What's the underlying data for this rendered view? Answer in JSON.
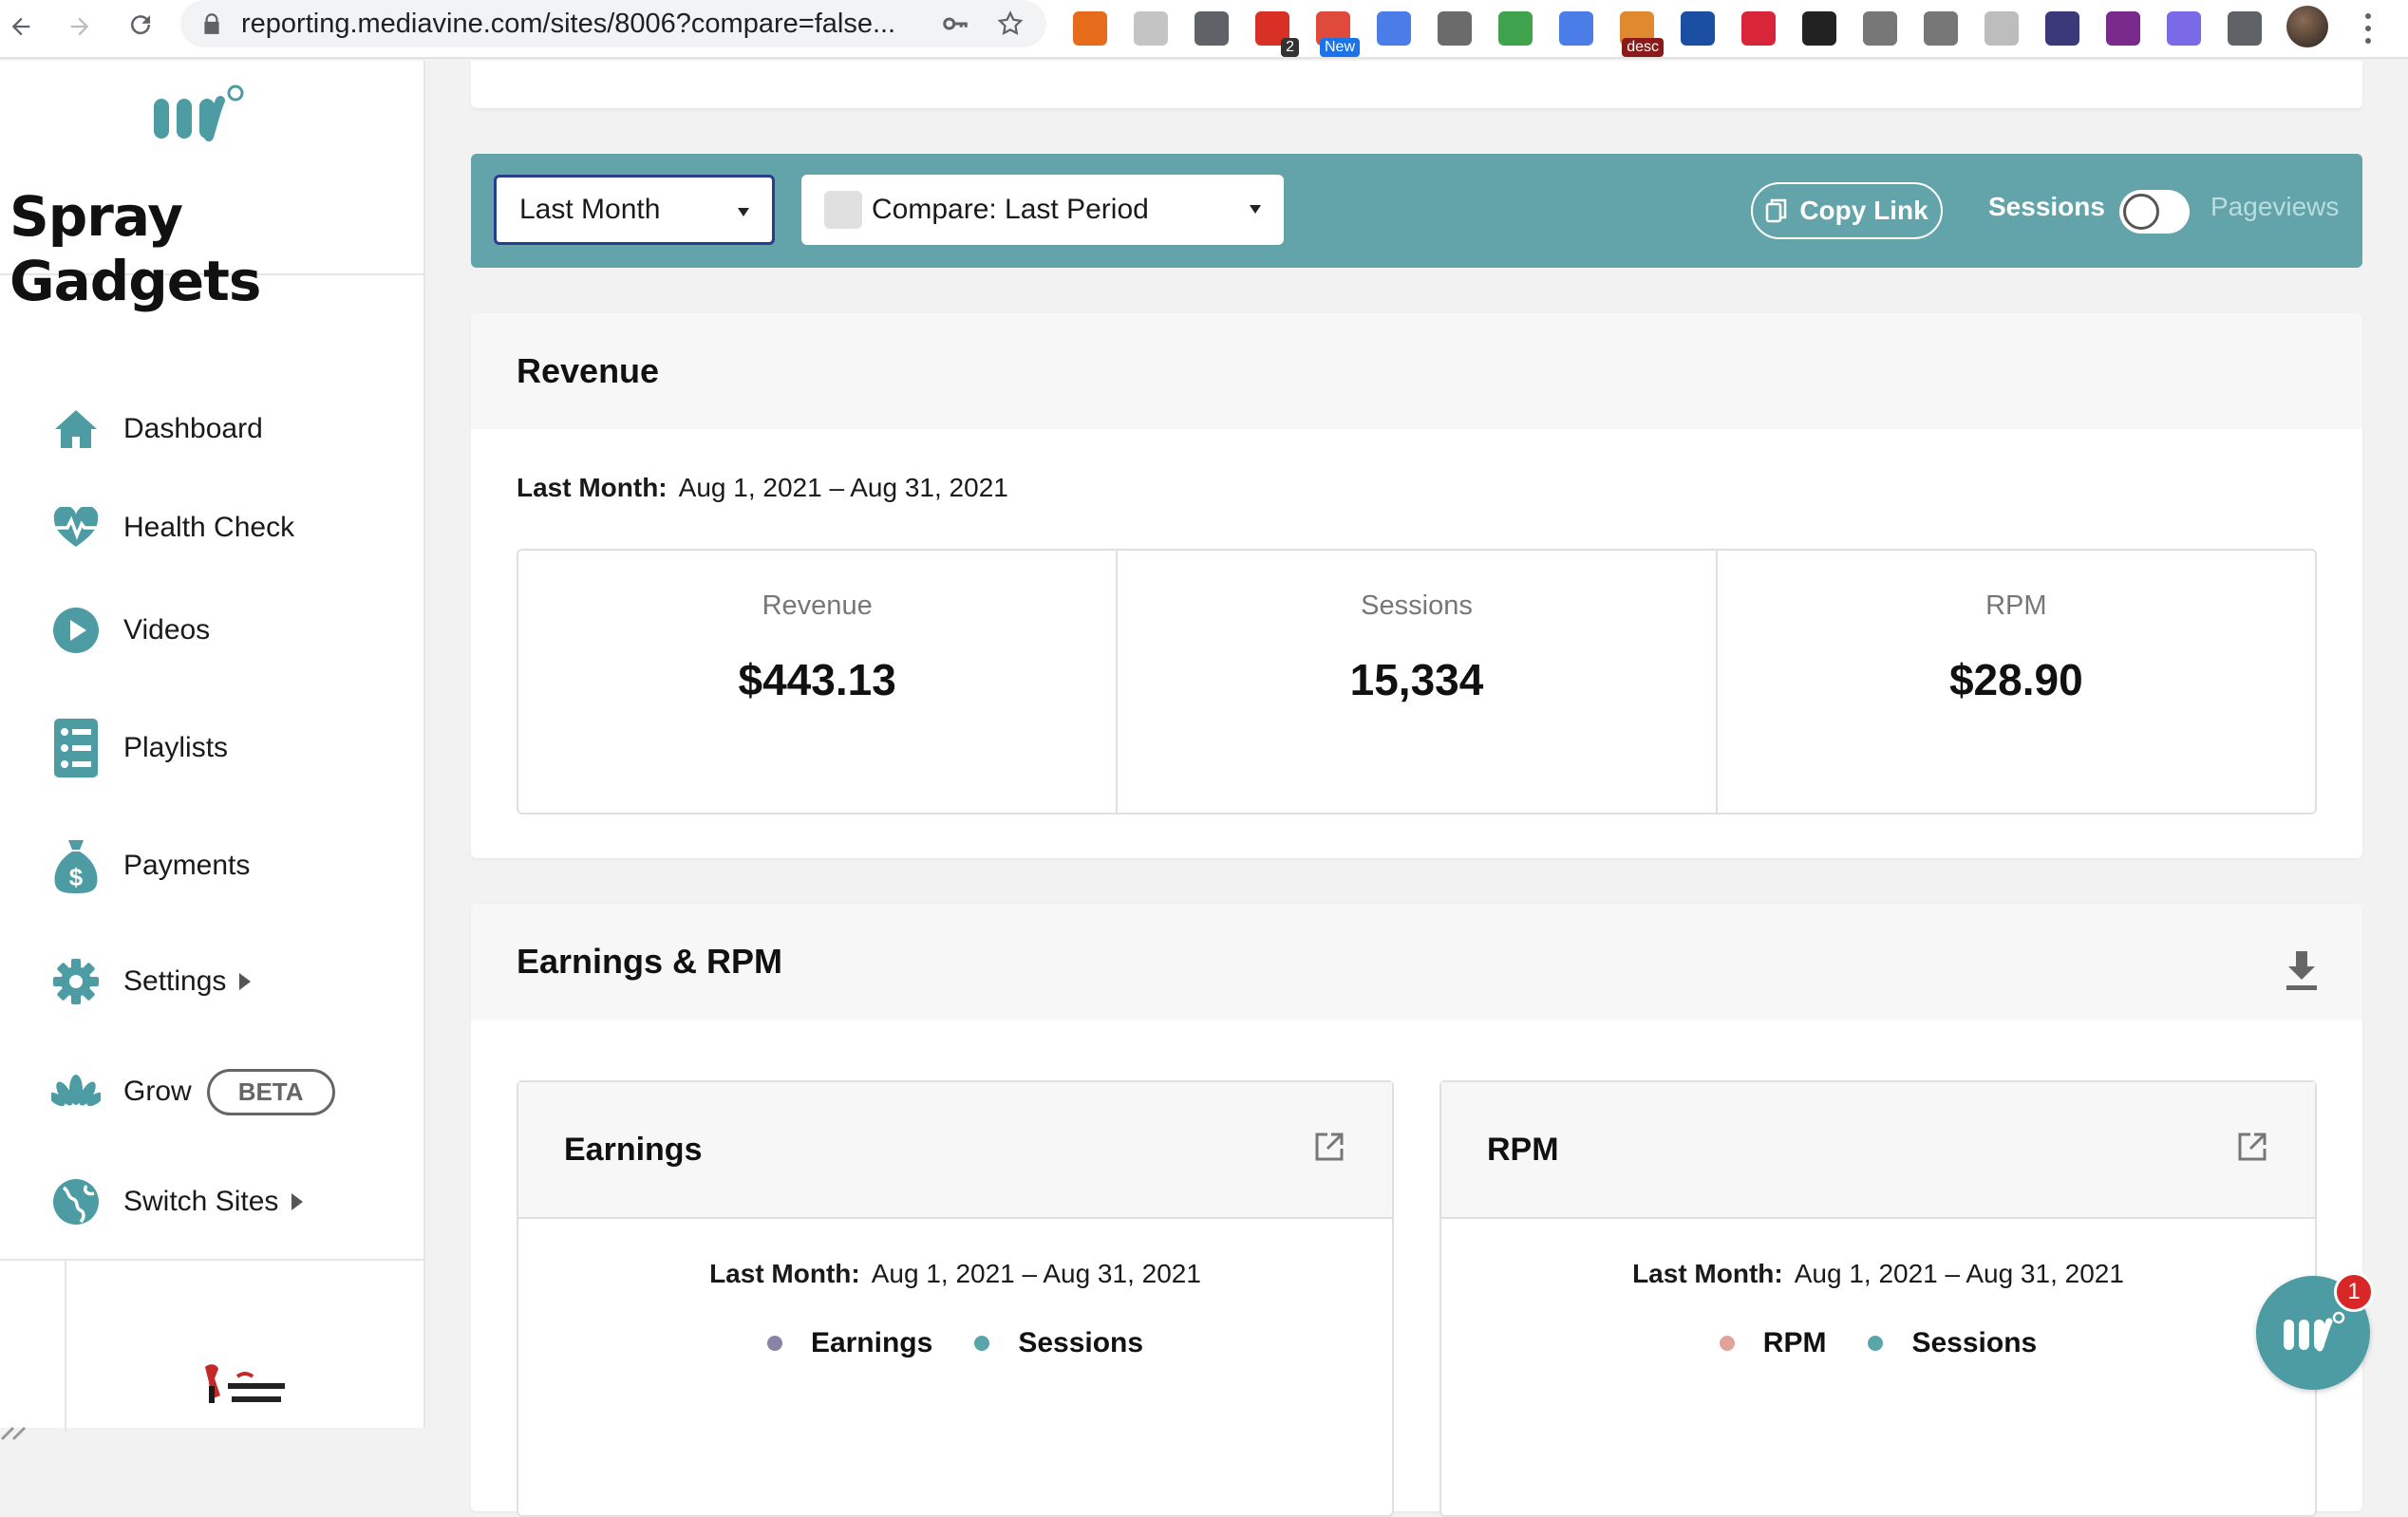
{
  "browser": {
    "url": "reporting.mediavine.com/sites/8006?compare=false...",
    "extensions": [
      {
        "name": "seo-extension-icon",
        "color": "#e66b1a",
        "badge": ""
      },
      {
        "name": "swirl-extension-icon",
        "color": "#c4c4c4",
        "badge": ""
      },
      {
        "name": "pocket-extension-icon",
        "color": "#5f6368",
        "badge": ""
      },
      {
        "name": "red-extension-icon",
        "color": "#d93025",
        "badge": "2"
      },
      {
        "name": "chrome-extension-icon",
        "color": "#e04a3a",
        "badge": "New"
      },
      {
        "name": "blue-folder-extension-icon",
        "color": "#4a7de8",
        "badge": ""
      },
      {
        "name": "chat-extension-icon",
        "color": "#6b6b6b",
        "badge": ""
      },
      {
        "name": "print-extension-icon",
        "color": "#3fa34d",
        "badge": ""
      },
      {
        "name": "link-extension-icon",
        "color": "#4a7de8",
        "badge": ""
      },
      {
        "name": "desc-extension-icon",
        "color": "#e0892e",
        "badge": "desc"
      },
      {
        "name": "plane-extension-icon",
        "color": "#1a4fa3",
        "badge": ""
      },
      {
        "name": "arrow-extension-icon",
        "color": "#d9253a",
        "badge": ""
      },
      {
        "name": "check-extension-icon",
        "color": "#222222",
        "badge": ""
      },
      {
        "name": "mail-extension-icon",
        "color": "#777777",
        "badge": ""
      },
      {
        "name": "camera-extension-icon",
        "color": "#777777",
        "badge": ""
      },
      {
        "name": "k-extension-icon",
        "color": "#bdbdbd",
        "badge": ""
      },
      {
        "name": "calendar-extension-icon",
        "color": "#3a3a7a",
        "badge": ""
      },
      {
        "name": "purple-extension-icon",
        "color": "#7a2a8a",
        "badge": ""
      },
      {
        "name": "snowflake-extension-icon",
        "color": "#7a6ae8",
        "badge": ""
      },
      {
        "name": "puzzle-extension-icon",
        "color": "#5f6368",
        "badge": ""
      }
    ]
  },
  "sidebar": {
    "site_name": "Spray Gadgets",
    "items": [
      {
        "label": "Dashboard",
        "icon": "home-icon"
      },
      {
        "label": "Health Check",
        "icon": "heartbeat-icon"
      },
      {
        "label": "Videos",
        "icon": "play-icon"
      },
      {
        "label": "Playlists",
        "icon": "list-icon"
      },
      {
        "label": "Payments",
        "icon": "money-bag-icon"
      },
      {
        "label": "Settings",
        "icon": "gear-icon"
      },
      {
        "label": "Grow",
        "icon": "lotus-icon"
      },
      {
        "label": "Switch Sites",
        "icon": "globe-icon"
      }
    ],
    "grow_badge": "BETA",
    "accent": "#4d9ca3"
  },
  "filters": {
    "date_range": "Last Month",
    "compare": "Compare: Last Period",
    "copy_link": "Copy Link",
    "toggle_on": "Sessions",
    "toggle_off": "Pageviews",
    "bar_color": "#63a4aa"
  },
  "revenue": {
    "title": "Revenue",
    "period_label": "Last Month:",
    "period_range": "Aug 1, 2021 – Aug 31, 2021",
    "metrics": [
      {
        "label": "Revenue",
        "value": "$443.13"
      },
      {
        "label": "Sessions",
        "value": "15,334"
      },
      {
        "label": "RPM",
        "value": "$28.90"
      }
    ]
  },
  "earnings_rpm": {
    "title": "Earnings & RPM",
    "earnings": {
      "title": "Earnings",
      "period_label": "Last Month:",
      "period_range": "Aug 1, 2021 – Aug 31, 2021",
      "legend": [
        {
          "label": "Earnings",
          "color": "#8a83a8"
        },
        {
          "label": "Sessions",
          "color": "#5aa5a9"
        }
      ]
    },
    "rpm": {
      "title": "RPM",
      "period_label": "Last Month:",
      "period_range": "Aug 1, 2021 – Aug 31, 2021",
      "legend": [
        {
          "label": "RPM",
          "color": "#e0a49a"
        },
        {
          "label": "Sessions",
          "color": "#5aa5a9"
        }
      ]
    }
  },
  "chat": {
    "badge": "1"
  }
}
